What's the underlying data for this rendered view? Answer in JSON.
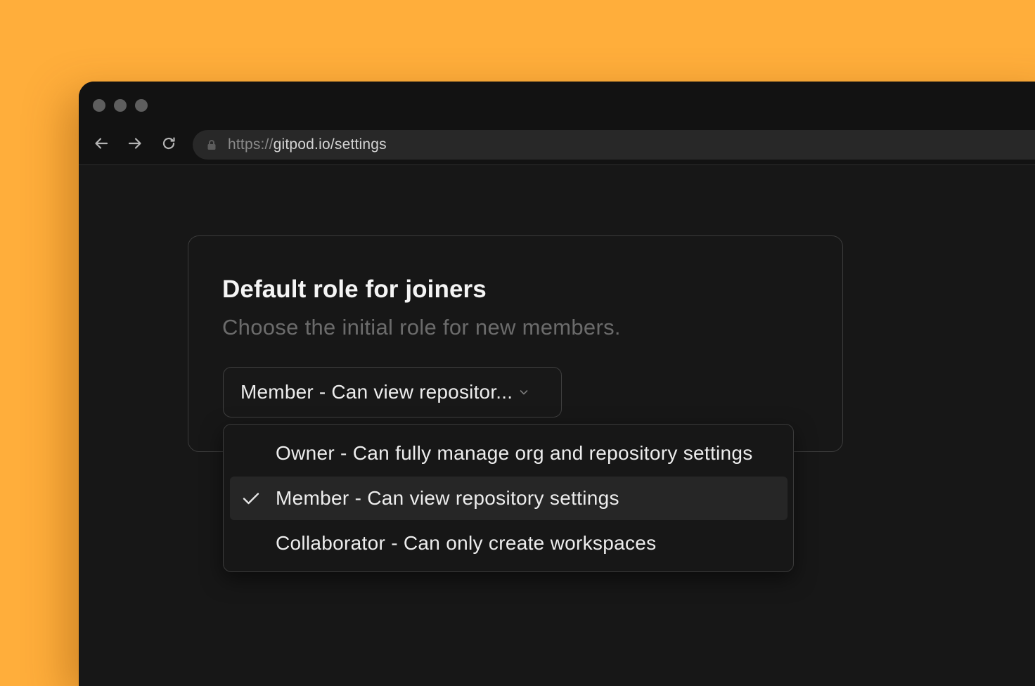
{
  "browser": {
    "url_protocol": "https://",
    "url_host_path": "gitpod.io/settings",
    "controls": {
      "back_icon": "arrow-left-icon",
      "forward_icon": "arrow-right-icon",
      "reload_icon": "reload-icon",
      "lock_icon": "lock-icon"
    }
  },
  "settings": {
    "title": "Default role for joiners",
    "subtitle": "Choose the initial role for new members.",
    "select": {
      "value": "Member - Can view repositor...",
      "chevron_icon": "chevron-down-icon"
    },
    "dropdown": {
      "options": [
        {
          "label": "Owner - Can fully manage org and repository settings",
          "selected": false
        },
        {
          "label": "Member - Can view repository settings",
          "selected": true
        },
        {
          "label": "Collaborator - Can only create workspaces",
          "selected": false
        }
      ],
      "check_icon": "check-icon"
    }
  },
  "colors": {
    "background": "#FFAE3B",
    "window": "#171717",
    "titlebar": "#121212",
    "border": "#3b3b3b",
    "text_primary": "#f5f5f5",
    "text_muted": "#6b6b6b",
    "selected_row": "#262626"
  }
}
